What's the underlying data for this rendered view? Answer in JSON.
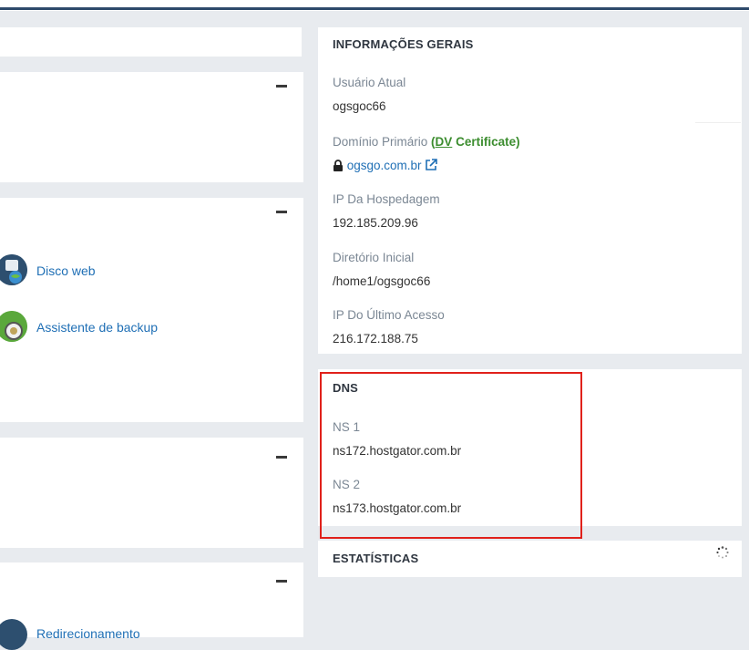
{
  "left_panel": {
    "apps": [
      {
        "label": "Disco web",
        "icon": "web-disk-icon"
      },
      {
        "label": "Assistente de backup",
        "icon": "backup-wizard-icon"
      },
      {
        "label": "Redirecionamento",
        "icon": "redirect-icon"
      }
    ]
  },
  "general_info": {
    "title": "INFORMAÇÕES GERAIS",
    "current_user_label": "Usuário Atual",
    "current_user_value": "ogsgoc66",
    "primary_domain_label": "Domínio Primário",
    "certificate_open": "(",
    "certificate_link": "DV",
    "certificate_rest": " Certificate)",
    "primary_domain_value": "ogsgo.com.br",
    "hosting_ip_label": "IP Da Hospedagem",
    "hosting_ip_value": "192.185.209.96",
    "home_dir_label": "Diretório Inicial",
    "home_dir_value": "/home1/ogsgoc66",
    "last_ip_label": "IP Do Último Acesso",
    "last_ip_value": "216.172.188.75"
  },
  "dns": {
    "title": "DNS",
    "ns1_label": "NS 1",
    "ns1_value": "ns172.hostgator.com.br",
    "ns2_label": "NS 2",
    "ns2_value": "ns173.hostgator.com.br"
  },
  "stats": {
    "title": "ESTATÍSTICAS"
  },
  "colors": {
    "link": "#1f6fb5",
    "certificate": "#3c8d2f",
    "highlight": "#e0211b",
    "topbar": "#2e4a6b"
  }
}
